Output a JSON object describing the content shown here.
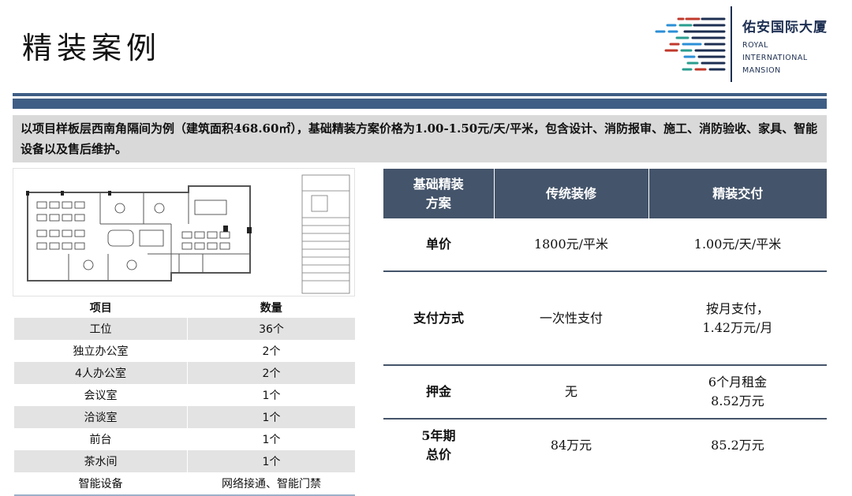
{
  "page": {
    "title": "精装案例"
  },
  "logo": {
    "cn_name": "佑安国际大厦",
    "en_line1": "ROYAL",
    "en_line2": "INTERNATIONAL",
    "en_line3": "MANSION",
    "colors": [
      "#1d2f52",
      "#c0392b",
      "#2b8fd6",
      "#2a9d8f"
    ]
  },
  "intro": {
    "text": "以项目样板层西南角隔间为例（建筑面积468.60㎡），基础精装方案价格为1.00-1.50元/天/平米，包含设计、消防报审、施工、消防验收、家具、智能设备以及售后维护。"
  },
  "floorplan": {
    "icon": "floor-plan-drawing"
  },
  "room_table": {
    "headers": [
      "项目",
      "数量"
    ],
    "rows": [
      {
        "item": "工位",
        "qty": "36个"
      },
      {
        "item": "独立办公室",
        "qty": "2个"
      },
      {
        "item": "4人办公室",
        "qty": "2个"
      },
      {
        "item": "会议室",
        "qty": "1个"
      },
      {
        "item": "洽谈室",
        "qty": "1个"
      },
      {
        "item": "前台",
        "qty": "1个"
      },
      {
        "item": "茶水间",
        "qty": "1个"
      },
      {
        "item": "智能设备",
        "qty": "网络接通、智能门禁"
      }
    ]
  },
  "price_table": {
    "headers": [
      "基础精装\n方案",
      "传统装修",
      "精装交付"
    ],
    "rows": [
      {
        "label": "单价",
        "traditional": "1800元/平米",
        "delivered": "1.00元/天/平米"
      },
      {
        "label": "支付方式",
        "traditional": "一次性支付",
        "delivered": "按月支付，\n1.42万元/月"
      },
      {
        "label": "押金",
        "traditional": "无",
        "delivered": "6个月租金\n8.52万元"
      },
      {
        "label": "5年期\n总价",
        "traditional": "84万元",
        "delivered": "85.2万元"
      }
    ],
    "header_color": "#44546a"
  }
}
